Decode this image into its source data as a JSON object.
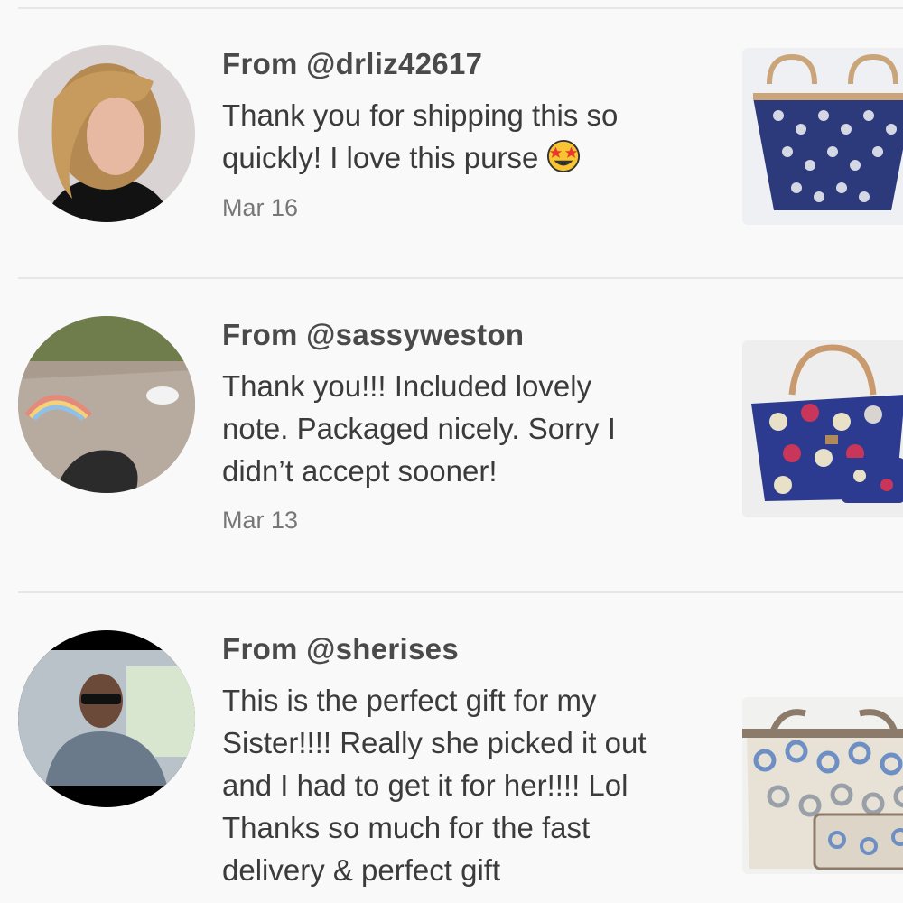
{
  "reviews": [
    {
      "from": "From @drliz42617",
      "lines": [
        "Thank you for shipping this so",
        "quickly! I love this purse"
      ],
      "emoji": "star-struck-emoji",
      "date": "Mar 16"
    },
    {
      "from": "From @sassyweston",
      "lines": [
        "Thank you!!! Included lovely",
        "note. Packaged nicely. Sorry I",
        "didn’t accept sooner!"
      ],
      "date": "Mar 13"
    },
    {
      "from": "From @sherises",
      "lines": [
        "This is the perfect gift for my",
        "Sister!!!! Really she picked it out",
        "and I had to get it for her!!!! Lol",
        "Thanks so much for the fast",
        "delivery & perfect gift"
      ]
    }
  ]
}
